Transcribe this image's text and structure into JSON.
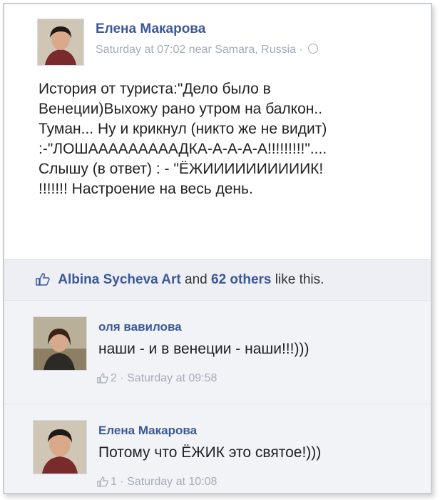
{
  "post": {
    "author": "Елена Макарова",
    "meta": "Saturday at 07:02 near Samara, Russia ·",
    "lines": [
      "История от туриста:\"Дело было в",
      "Венеции)Выхожу рано утром на балкон..",
      "Туман... Ну и крикнул (никто же не видит)",
      ":-\"ЛОШАААААААААДКА-А-А-А-А!!!!!!!!!\"....",
      "Слышу (в ответ) : - \"ЁЖИИИИИИИИИИК!",
      "!!!!!!! Настроение на весь день."
    ]
  },
  "likes": {
    "name": "Albina Sycheva Art",
    "and": " and ",
    "others": "62 others",
    "suffix": " like this."
  },
  "comments": [
    {
      "author": "оля вавилова",
      "text": "наши - и в венеции - наши!!!)))",
      "likes": "2",
      "time": "· Saturday at 09:58"
    },
    {
      "author": "Елена Макарова",
      "text": "Потому что ЁЖИК это святое!)))",
      "likes": "1",
      "time": "· Saturday at 10:08"
    }
  ],
  "colors": {
    "link": "#3b5998",
    "meta": "#a3abbb",
    "comment_bg": "#f2f3f7",
    "likes_bg": "#edeff4"
  },
  "icons": [
    "thumbs-up-icon",
    "globe-icon"
  ]
}
